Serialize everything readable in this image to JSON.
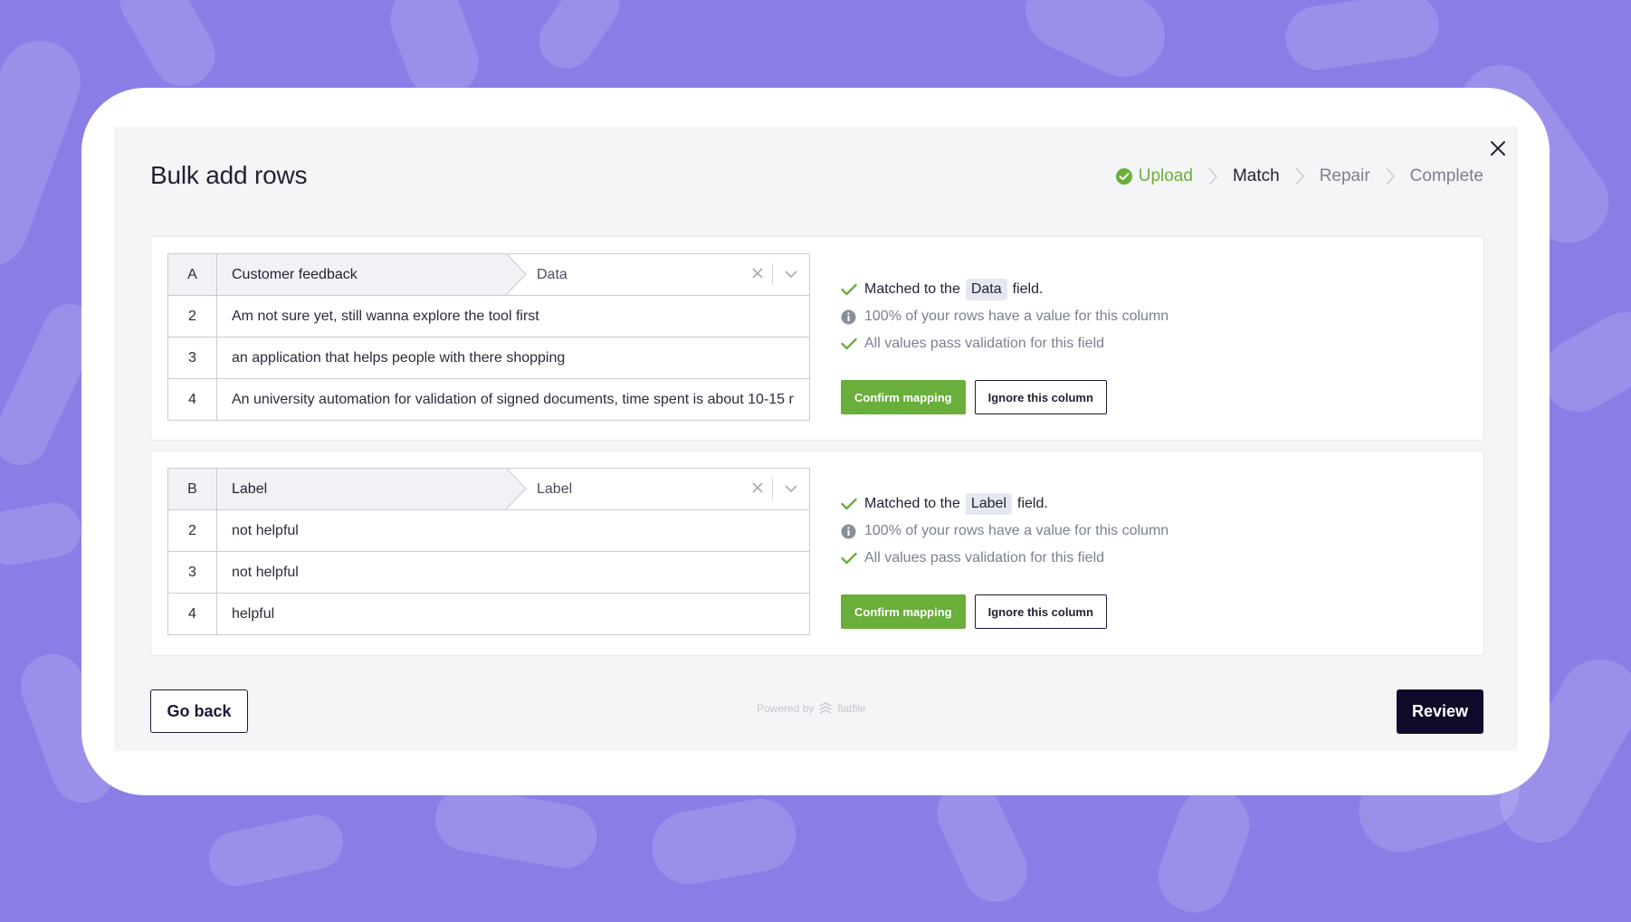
{
  "modal": {
    "title": "Bulk add rows"
  },
  "steps": [
    {
      "label": "Upload",
      "state": "done"
    },
    {
      "label": "Match",
      "state": "active"
    },
    {
      "label": "Repair",
      "state": "pending"
    },
    {
      "label": "Complete",
      "state": "pending"
    }
  ],
  "columns": [
    {
      "letter": "A",
      "header": "Customer feedback",
      "field": "Data",
      "rows": [
        {
          "num": "2",
          "value": "Am not sure yet, still wanna explore the tool first"
        },
        {
          "num": "3",
          "value": "an application that helps people with there shopping"
        },
        {
          "num": "4",
          "value": "An university automation for validation of signed documents, time spent is about 10-15 r"
        }
      ],
      "status": {
        "matched_prefix": "Matched to the",
        "matched_field": "Data",
        "matched_suffix": "field.",
        "coverage": "100% of your rows have a value for this column",
        "validation": "All values pass validation for this field"
      },
      "confirm_label": "Confirm mapping",
      "ignore_label": "Ignore this column"
    },
    {
      "letter": "B",
      "header": "Label",
      "field": "Label",
      "rows": [
        {
          "num": "2",
          "value": "not helpful"
        },
        {
          "num": "3",
          "value": "not helpful"
        },
        {
          "num": "4",
          "value": "helpful"
        }
      ],
      "status": {
        "matched_prefix": "Matched to the",
        "matched_field": "Label",
        "matched_suffix": "field.",
        "coverage": "100% of your rows have a value for this column",
        "validation": "All values pass validation for this field"
      },
      "confirm_label": "Confirm mapping",
      "ignore_label": "Ignore this column"
    }
  ],
  "footer": {
    "go_back_label": "Go back",
    "powered_by": "Powered by",
    "brand": "flatfile",
    "review_label": "Review"
  },
  "icons": {
    "close": "close-icon",
    "step_done": "check-circle-icon",
    "step_separator": "chevron-right-icon",
    "clear": "clear-icon",
    "dropdown": "chevron-down-icon",
    "check": "check-icon",
    "info": "info-icon",
    "brand": "flatfile-logo-icon"
  },
  "colors": {
    "background": "#8a7ee6",
    "accent_green": "#6aae3b",
    "primary_dark": "#0e0b2a"
  }
}
